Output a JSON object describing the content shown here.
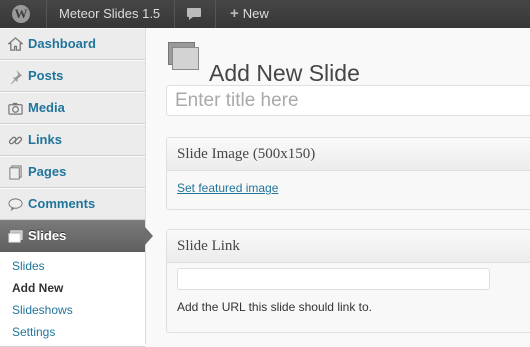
{
  "admin_bar": {
    "logo_glyph": "W",
    "site_name": "Meteor Slides 1.5",
    "comments_icon": "speech-bubble-icon",
    "new_label": "New",
    "new_icon": "plus-icon"
  },
  "sidebar": {
    "menu": [
      {
        "label": "Dashboard",
        "icon": "dashboard-house-icon"
      },
      {
        "label": "Posts",
        "icon": "pushpin-icon"
      },
      {
        "label": "Media",
        "icon": "media-camera-icon"
      },
      {
        "label": "Links",
        "icon": "chain-link-icon"
      },
      {
        "label": "Pages",
        "icon": "pages-icon"
      },
      {
        "label": "Comments",
        "icon": "comment-bubble-icon"
      },
      {
        "label": "Slides",
        "icon": "slides-icon",
        "active": true
      }
    ],
    "submenu": [
      "Slides",
      "Add New",
      "Slideshows",
      "Settings"
    ],
    "current_submenu": "Add New"
  },
  "main": {
    "page_title": "Add New Slide",
    "title_placeholder": "Enter title here",
    "title_value": "",
    "image_box": {
      "heading": "Slide Image (500x150)",
      "link_label": "Set featured image"
    },
    "link_box": {
      "heading": "Slide Link",
      "url_value": "",
      "help_text": "Add the URL this slide should link to."
    }
  },
  "colors": {
    "admin_bar": "#464646",
    "link": "#21759b",
    "active_menu": "#6d6d6d",
    "sidebar_bg": "#ececec"
  }
}
